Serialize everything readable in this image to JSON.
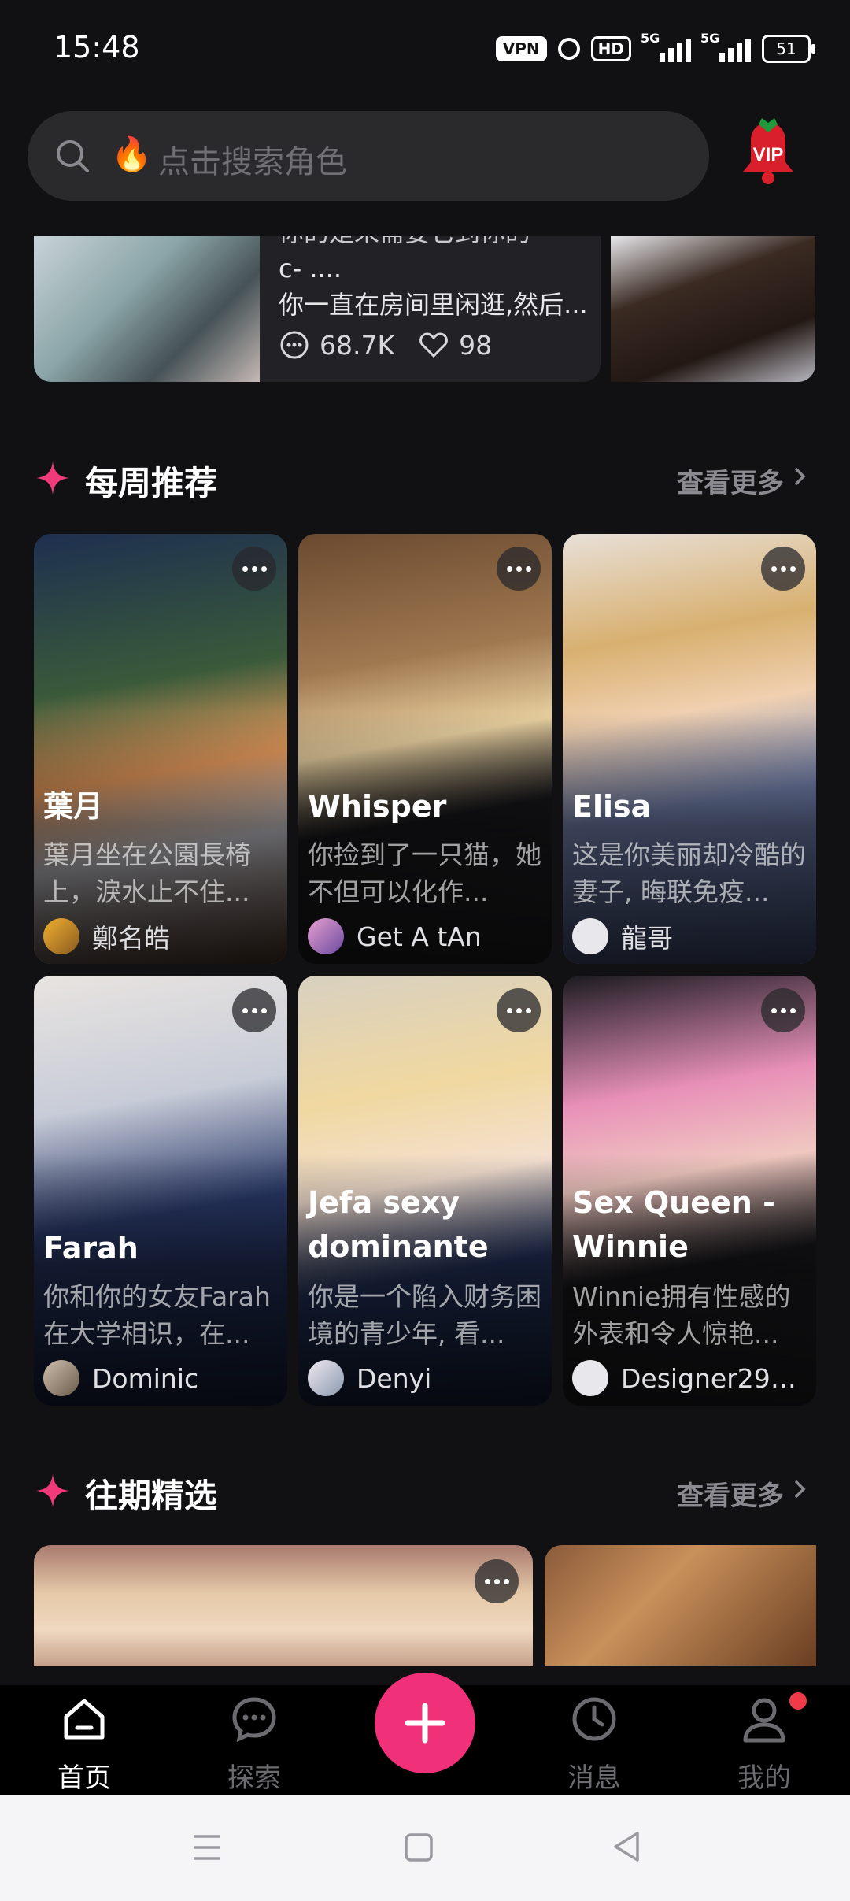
{
  "status_bar": {
    "time": "15:48",
    "vpn": "VPN",
    "hd": "HD",
    "signal1": "5G",
    "signal2": "5G",
    "battery": "51"
  },
  "search": {
    "placeholder": "点击搜索角色",
    "vip_label": "VIP"
  },
  "carousel": {
    "line1": "你的是来需要它到你的",
    "line2": "c- ....",
    "line3": "你一直在房间里闲逛,然后...",
    "chats": "68.7K",
    "likes": "98"
  },
  "weekly": {
    "title": "每周推荐",
    "more": "查看更多",
    "cards": [
      {
        "name": "葉月",
        "desc": "葉月坐在公園長椅上，淚水止不住...",
        "author": "鄭名皓"
      },
      {
        "name": "Whisper",
        "desc": "你捡到了一只猫，她不但可以化作...",
        "author": "Get A tAn"
      },
      {
        "name": "Elisa",
        "desc": "这是你美丽却冷酷的妻子, 晦联免疫...",
        "author": "龍哥"
      },
      {
        "name": "Farah",
        "desc": "你和你的女友Farah在大学相识，在...",
        "author": "Dominic"
      },
      {
        "name": "Jefa sexy dominante",
        "desc": "你是一个陷入财务困境的青少年, 看...",
        "author": "Denyi"
      },
      {
        "name": "Sex Queen - Winnie",
        "desc": "Winnie拥有性感的外表和令人惊艳...",
        "author": "Designer292..."
      }
    ]
  },
  "past": {
    "title": "往期精选",
    "more": "查看更多"
  },
  "nav": {
    "home": "首页",
    "explore": "探索",
    "messages": "消息",
    "mine": "我的"
  }
}
